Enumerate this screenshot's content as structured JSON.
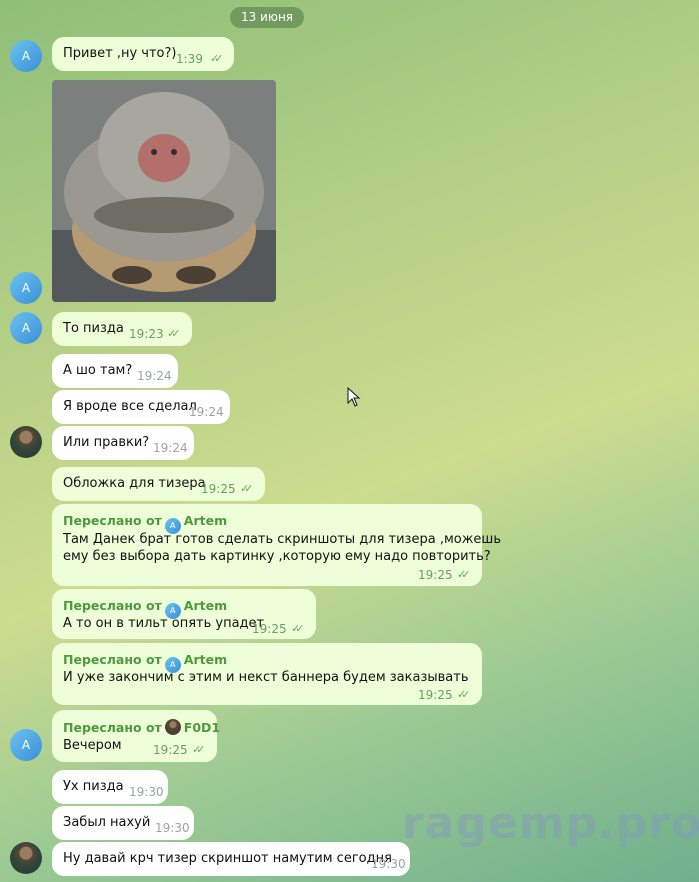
{
  "date": "13 июня",
  "messages": [
    {
      "text": "Привет ,ну что?)",
      "time": "1:39"
    },
    {
      "text": "То пизда",
      "time": "19:23"
    },
    {
      "text": "А шо там?",
      "time": "19:24"
    },
    {
      "text": "Я вроде все сделал",
      "time": "19:24"
    },
    {
      "text": "Или правки?",
      "time": "19:24"
    },
    {
      "text": "Обложка для тизера",
      "time": "19:25"
    },
    {
      "fwd_label": "Переслано от",
      "fwd_name": "Artem",
      "line1": "Там Данек брат готов сделать скриншоты для тизера ,можешь",
      "line2": "ему без выбора дать картинку ,которую ему надо повторить?",
      "time": "19:25"
    },
    {
      "fwd_label": "Переслано от",
      "fwd_name": "Artem",
      "text": "А то он в тильт опять упадет",
      "time": "19:25"
    },
    {
      "fwd_label": "Переслано от",
      "fwd_name": "Artem",
      "text": "И уже закончим с этим и некст баннера будем заказывать",
      "time": "19:25"
    },
    {
      "fwd_label": "Переслано от",
      "fwd_name": "F0D1",
      "text": "Вечером",
      "time": "19:25"
    },
    {
      "text": "Ух пизда",
      "time": "19:30"
    },
    {
      "text": "Забыл нахуй",
      "time": "19:30"
    },
    {
      "text": "Ну давай крч тизер скриншот намутим сегодня",
      "time": "19:30"
    }
  ],
  "avatar_letter": "A",
  "fwd_avatar_letter": "A",
  "check_mark": "✓✓",
  "watermark": "ragemp.pro"
}
